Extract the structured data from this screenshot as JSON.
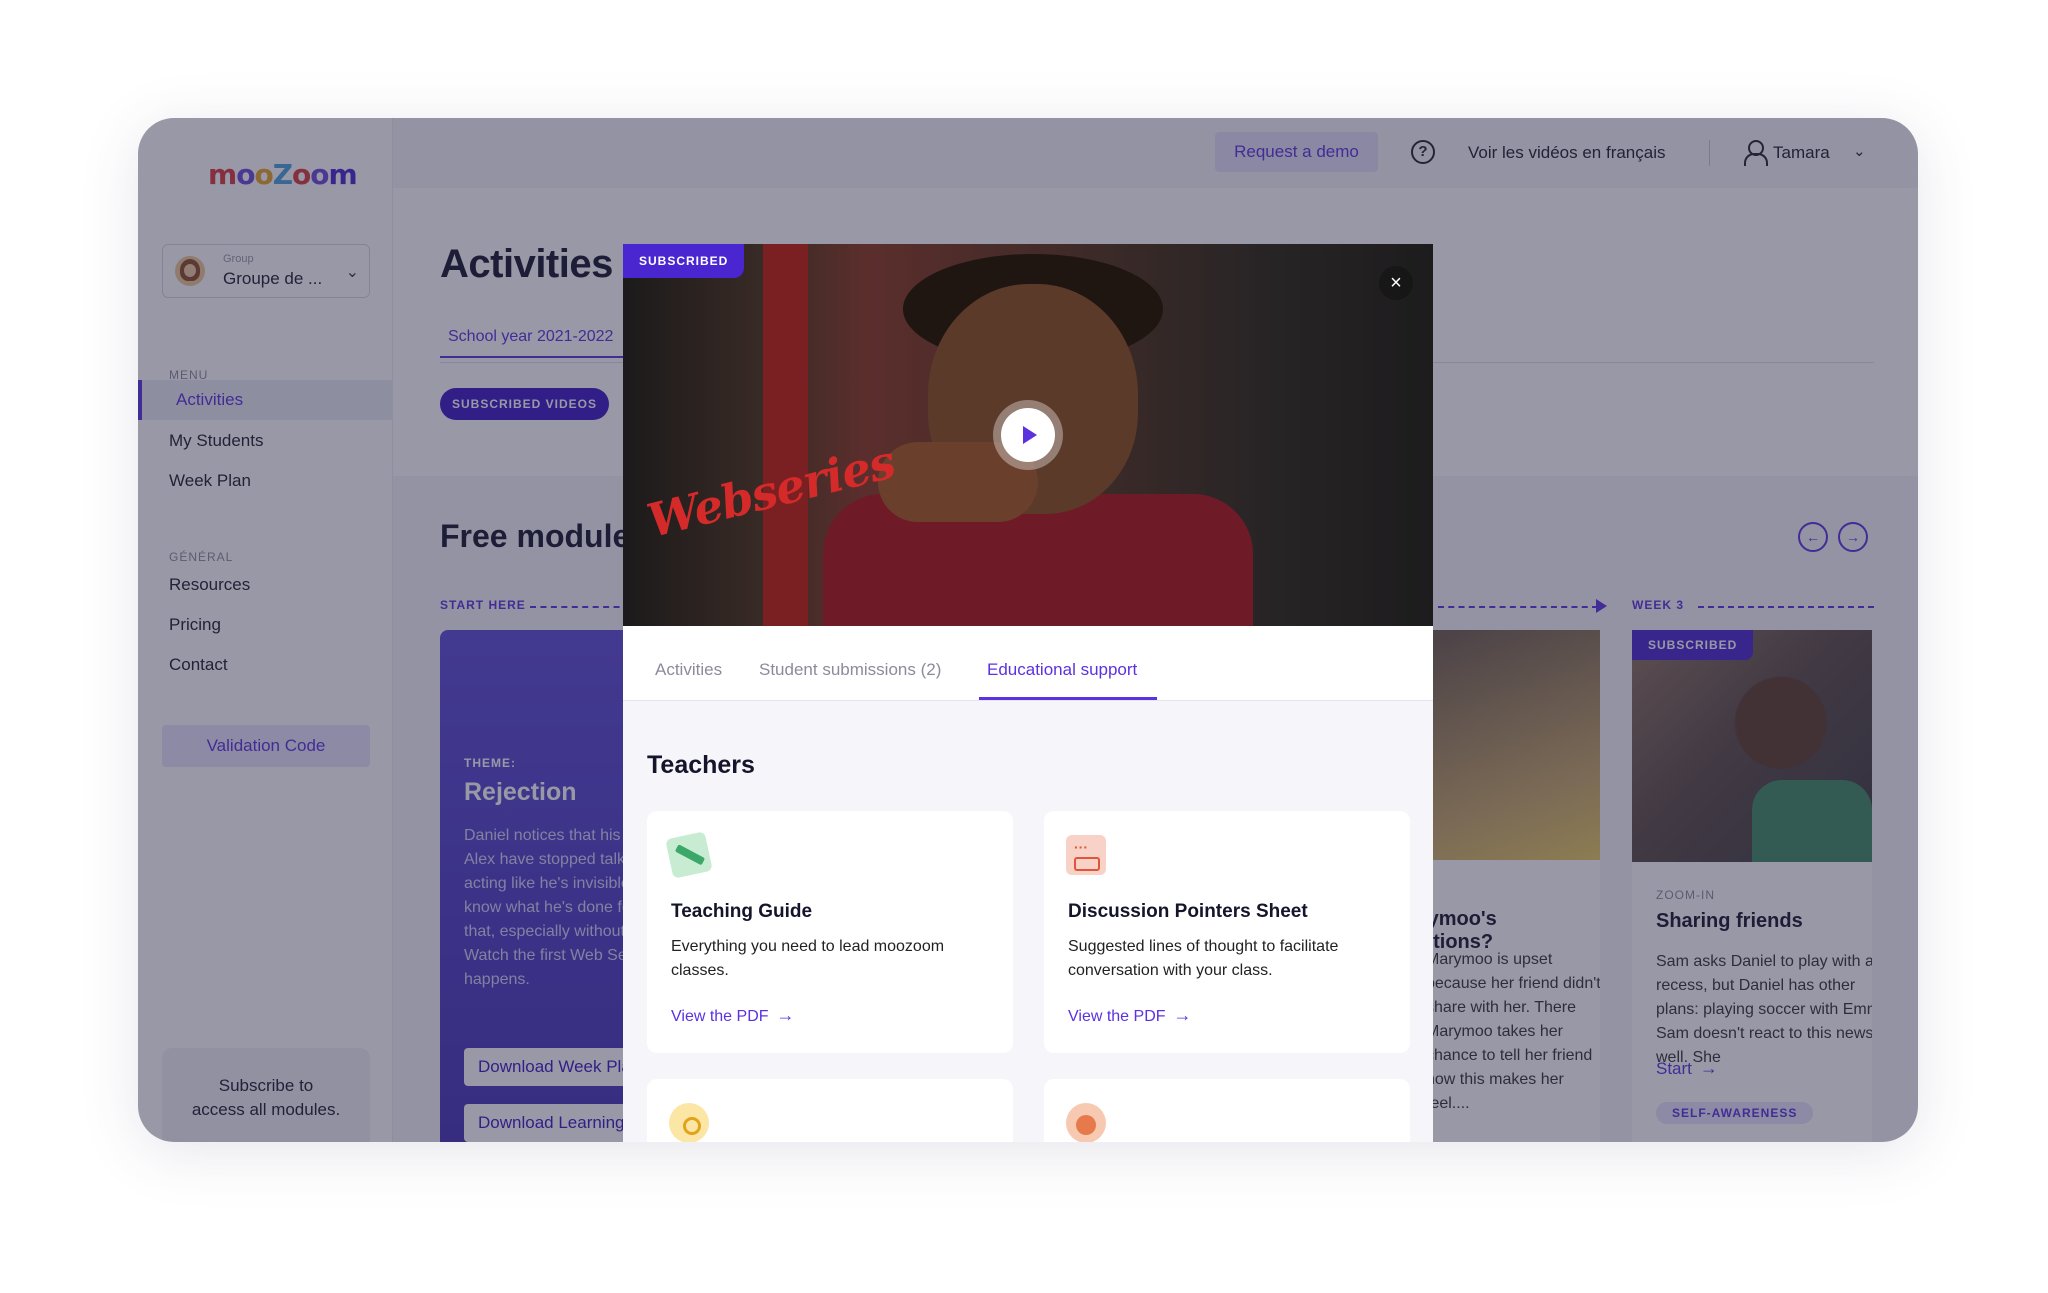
{
  "logo": {
    "text": "mooZoom",
    "colors": [
      "#d9393a",
      "#6a48d8",
      "#e8a321",
      "#4aa0d8",
      "#d9393a",
      "#6a48d8",
      "#4a26d0"
    ]
  },
  "sidebar": {
    "group_small": "Group",
    "group_name": "Groupe de ...",
    "menu_heading": "MENU",
    "menu_items": [
      {
        "label": "Activities",
        "active": true
      },
      {
        "label": "My Students",
        "active": false
      },
      {
        "label": "Week Plan",
        "active": false
      }
    ],
    "general_heading": "GÉNÉRAL",
    "general_items": [
      {
        "label": "Resources"
      },
      {
        "label": "Pricing"
      },
      {
        "label": "Contact"
      }
    ],
    "validation_button": "Validation Code",
    "subscribe_text": "Subscribe to access all modules."
  },
  "topbar": {
    "demo_button": "Request a demo",
    "help_icon": "?",
    "french_link": "Voir les vidéos en français",
    "user_name": "Tamara"
  },
  "main": {
    "title": "Activities",
    "year_tab": "School year 2021-2022",
    "chip": "SUBSCRIBED VIDEOS",
    "section_title": "Free modules",
    "start_here": "START HERE",
    "week3": "WEEK 3",
    "theme_card": {
      "label": "THEME:",
      "name": "Rejection",
      "description": "Daniel notices that his friends Emma and Alex have stopped talking to him. They're acting like he's invisible. Daniel doesn't know what he's done for them to act like that, especially without any explanation. Watch the first Web Series to see what happens.",
      "button_week": "Download Week Plan",
      "button_learning": "Download Learning Guide"
    },
    "mid_card": {
      "title": "Marymoo's emotions?",
      "description": "Marymoo is upset because her friend didn't share with her. There Marymoo takes her chance to tell her friend how this makes her feel...."
    },
    "right_card": {
      "badge": "SUBSCRIBED",
      "kicker": "ZOOM-IN",
      "title": "Sharing friends",
      "description": "Sam asks Daniel to play with at recess, but Daniel has other plans: playing soccer with Emma. Sam doesn't react to this news well. She",
      "start": "Start",
      "tag": "SELF-AWARENESS"
    }
  },
  "modal": {
    "badge": "SUBSCRIBED",
    "close_icon": "×",
    "video_title_overlay": "Webseries",
    "tabs": [
      {
        "label": "Activities",
        "active": false
      },
      {
        "label": "Student submissions (2)",
        "active": false
      },
      {
        "label": "Educational support",
        "active": true
      }
    ],
    "section_title": "Teachers",
    "cards": [
      {
        "icon": "pencil-icon",
        "title": "Teaching Guide",
        "description": "Everything you need to lead moozoom classes.",
        "link": "View the PDF"
      },
      {
        "icon": "chat-icon",
        "title": "Discussion Pointers Sheet",
        "description": "Suggested lines of thought to facilitate conversation with your class.",
        "link": "View the PDF"
      },
      {
        "icon": "key-icon",
        "title": "",
        "description": "",
        "link": ""
      },
      {
        "icon": "person-icon",
        "title": "",
        "description": "",
        "link": ""
      }
    ],
    "link_arrow": "→"
  },
  "colors": {
    "accent": "#5b31e0",
    "badge": "#4a26d0",
    "overlay": "rgba(40,40,70,0.48)"
  }
}
